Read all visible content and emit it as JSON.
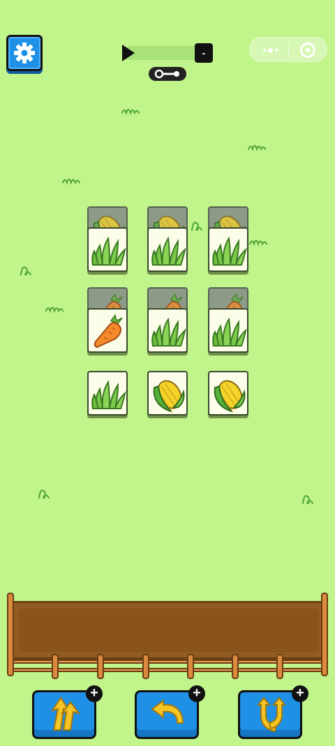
{
  "header": {
    "settings_icon": "gear-icon",
    "progress": {
      "fraction": 0.0,
      "end_label": "-"
    },
    "key_icon": "key-icon"
  },
  "capsule": {
    "more_icon": "more-dots-icon",
    "close_icon": "target-close-icon"
  },
  "board": {
    "tile_kinds": [
      "grass",
      "carrot",
      "corn"
    ],
    "tiles": [
      {
        "layer": "back",
        "kind": "corn"
      },
      {
        "layer": "back",
        "kind": "corn"
      },
      {
        "layer": "back",
        "kind": "corn"
      },
      {
        "layer": "front",
        "kind": "grass"
      },
      {
        "layer": "front",
        "kind": "grass"
      },
      {
        "layer": "front",
        "kind": "grass"
      },
      {
        "layer": "back",
        "kind": "carrot"
      },
      {
        "layer": "back",
        "kind": "carrot"
      },
      {
        "layer": "back",
        "kind": "carrot"
      },
      {
        "layer": "front",
        "kind": "carrot"
      },
      {
        "layer": "front",
        "kind": "grass"
      },
      {
        "layer": "front",
        "kind": "grass"
      },
      {
        "layer": "front",
        "kind": "grass"
      },
      {
        "layer": "front",
        "kind": "corn"
      },
      {
        "layer": "front",
        "kind": "corn"
      }
    ]
  },
  "tray": {
    "slots_filled": 0
  },
  "tools": [
    {
      "name": "remove",
      "icon": "pull-out-icon",
      "badge": "+"
    },
    {
      "name": "undo",
      "icon": "undo-arrow-icon",
      "badge": "+"
    },
    {
      "name": "shuffle",
      "icon": "shuffle-arrows-icon",
      "badge": "+"
    }
  ],
  "colors": {
    "background": "#c1f58c",
    "button": "#1e90e6",
    "tray": "#8b531c"
  }
}
